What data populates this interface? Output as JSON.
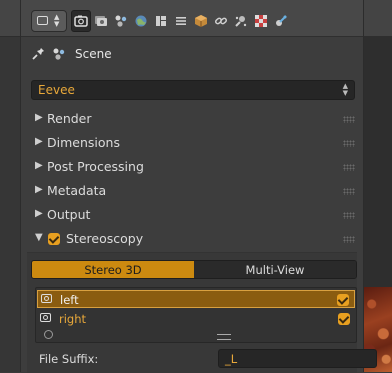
{
  "context_path": {
    "label": "Scene",
    "pin_icon": "pin-icon",
    "scene_icon": "scene-icon"
  },
  "header": {
    "editor_type_icon": "properties-icon",
    "tabs": [
      {
        "icon": "render-icon",
        "active": true
      },
      {
        "icon": "render-layers-icon",
        "active": false
      },
      {
        "icon": "scene-icon",
        "active": false
      },
      {
        "icon": "world-icon",
        "active": false
      },
      {
        "icon": "object-icon",
        "active": false
      },
      {
        "icon": "modifiers-icon",
        "active": false
      },
      {
        "icon": "data-icon",
        "active": false
      },
      {
        "icon": "constraints-icon",
        "active": false
      },
      {
        "icon": "particles-icon",
        "active": false
      },
      {
        "icon": "texture-icon",
        "active": false
      },
      {
        "icon": "physics-icon",
        "active": false
      }
    ]
  },
  "render_engine": {
    "value": "Eevee"
  },
  "sections": [
    {
      "label": "Render",
      "expanded": false
    },
    {
      "label": "Dimensions",
      "expanded": false
    },
    {
      "label": "Post Processing",
      "expanded": false
    },
    {
      "label": "Metadata",
      "expanded": false
    },
    {
      "label": "Output",
      "expanded": false
    },
    {
      "label": "Stereoscopy",
      "expanded": true,
      "checked": true
    }
  ],
  "stereoscopy": {
    "modes": [
      "Stereo 3D",
      "Multi-View"
    ],
    "active_mode": "Stereo 3D",
    "views": [
      {
        "name": "left",
        "selected": true,
        "enabled": true
      },
      {
        "name": "right",
        "selected": false,
        "enabled": true
      }
    ],
    "file_suffix_label": "File Suffix:",
    "file_suffix_value": "_L"
  },
  "colors": {
    "accent": "#e8a020",
    "accent_text": "#e8a83a",
    "panel_bg": "#3d3d3d"
  }
}
